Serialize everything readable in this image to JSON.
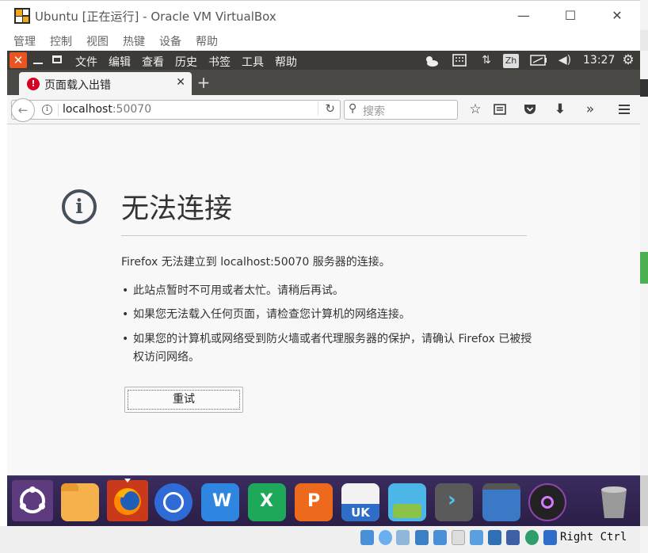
{
  "vbox": {
    "title": "Ubuntu [正在运行] - Oracle VM VirtualBox",
    "menu": [
      "管理",
      "控制",
      "视图",
      "热键",
      "设备",
      "帮助"
    ],
    "controls": {
      "minimize": "—",
      "maximize": "☐",
      "close": "✕"
    },
    "status": {
      "host_key": "Right Ctrl"
    }
  },
  "guest_panel": {
    "close_label": "✕",
    "menu": [
      "文件",
      "编辑",
      "查看",
      "历史",
      "书签",
      "工具",
      "帮助"
    ],
    "input_method": "Zh",
    "time": "13:27"
  },
  "tab": {
    "title": "页面载入出错",
    "close": "✕",
    "new_tab": "+"
  },
  "nav": {
    "back": "←",
    "url_host": "localhost",
    "url_port": ":50070",
    "reload": "↻",
    "search_placeholder": "搜索",
    "overflow": "»"
  },
  "error_page": {
    "icon": "i",
    "title": "无法连接",
    "description": "Firefox 无法建立到 localhost:50070 服务器的连接。",
    "bullets": [
      "此站点暂时不可用或者太忙。请稍后再试。",
      "如果您无法载入任何页面，请检查您计算机的网络连接。",
      "如果您的计算机或网络受到防火墙或者代理服务器的保护，请确认 Firefox 已被授权访问网络。"
    ],
    "retry_label": "重试"
  },
  "launcher": {
    "items": [
      "ubuntu-dash-icon",
      "files-icon",
      "firefox-icon",
      "chromium-icon",
      "wps-writer-icon",
      "wps-spreadsheet-icon",
      "wps-presentation-icon",
      "ubuntu-software-icon",
      "app-store-icon",
      "terminal-icon",
      "workspace-switcher-icon",
      "disc-icon",
      "trash-icon"
    ],
    "wps_letters": {
      "writer": "W",
      "sheet": "X",
      "present": "P"
    },
    "software_badge": "UK"
  },
  "colors": {
    "accent": "#e95420",
    "panel": "#3c3b37",
    "launcher": "#2b1f47",
    "error_red": "#d70022"
  }
}
